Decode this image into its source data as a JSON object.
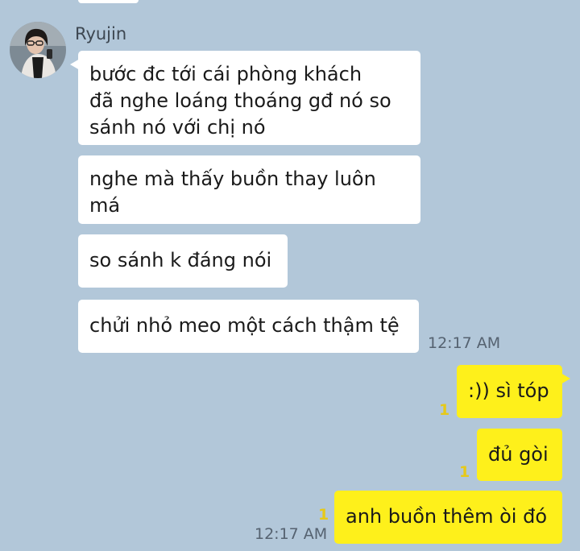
{
  "chat": {
    "sender_name": "Ryujin",
    "colors": {
      "background": "#b2c7d9",
      "incoming_bubble": "#ffffff",
      "outgoing_bubble": "#fef01b",
      "unread_count": "#e6c919"
    },
    "incoming": [
      {
        "lines": [
          "bước đc tới cái phòng khách",
          "đã nghe loáng thoáng gđ nó so",
          "sánh nó với chị nó"
        ]
      },
      {
        "lines": [
          "nghe mà thấy buồn thay luôn",
          "má"
        ]
      },
      {
        "lines": [
          "so sánh k đáng nói"
        ]
      },
      {
        "lines": [
          "chửi nhỏ meo một cách thậm tệ"
        ],
        "time": "12:17 AM"
      }
    ],
    "outgoing": [
      {
        "text": ":)) sì tóp",
        "unread": "1"
      },
      {
        "text": "đủ gòi",
        "unread": "1"
      },
      {
        "text": "anh buồn thêm òi đó",
        "unread": "1",
        "time": "12:17 AM"
      }
    ]
  }
}
